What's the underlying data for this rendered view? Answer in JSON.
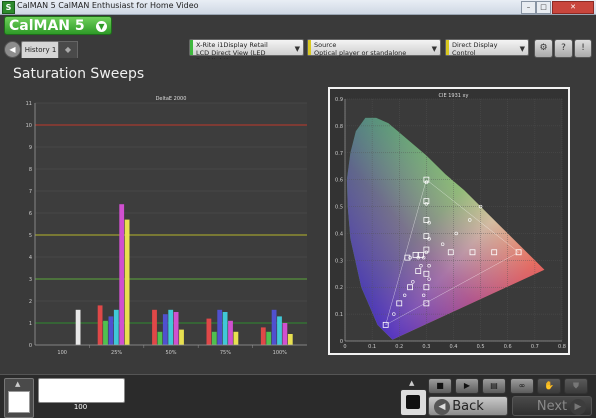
{
  "window": {
    "app_icon": "S",
    "title": "CalMAN 5 CalMAN Enthusiast for Home Video"
  },
  "header": {
    "logo": "CalMAN 5",
    "tab_active": "History 1",
    "meter_label": "X-Rite i1Display Retail",
    "meter_value": "LCD Direct View (LED Backlight)",
    "source_label": "Source",
    "source_value": "Optical player or standalone generator",
    "display_label": "Direct Display Control",
    "display_value": "",
    "colors": {
      "meter": "#3fb83f",
      "source": "#d8c81f",
      "display": "#d8c81f"
    }
  },
  "page": {
    "title": "Saturation Sweeps"
  },
  "chart_data": [
    {
      "type": "bar",
      "title": "DeltaE 2000",
      "categories": [
        "100",
        "25%",
        "50%",
        "75%",
        "100%"
      ],
      "ylim": [
        0,
        11
      ],
      "yticks": [
        0,
        1,
        2,
        3,
        4,
        5,
        6,
        7,
        8,
        9,
        10,
        11
      ],
      "threshold_lines": [
        {
          "y": 10,
          "color": "#c0392b"
        },
        {
          "y": 5,
          "color": "#b5b52a"
        },
        {
          "y": 3,
          "color": "#5aa63a"
        },
        {
          "y": 1,
          "color": "#2e8b2e"
        }
      ],
      "series": [
        {
          "color": "#e04848",
          "values": [
            0,
            1.8,
            1.6,
            1.2,
            0.8
          ]
        },
        {
          "color": "#50c050",
          "values": [
            0,
            1.1,
            0.6,
            0.6,
            0.6
          ]
        },
        {
          "color": "#5050d0",
          "values": [
            0,
            1.3,
            1.4,
            1.6,
            1.6
          ]
        },
        {
          "color": "#40c8d8",
          "values": [
            0,
            1.6,
            1.6,
            1.5,
            1.3
          ]
        },
        {
          "color": "#d050d0",
          "values": [
            0,
            6.4,
            1.5,
            1.1,
            1.0
          ]
        },
        {
          "color": "#e8e050",
          "values": [
            0,
            5.7,
            0.7,
            0.6,
            0.5
          ]
        },
        {
          "color": "#e8e8e8",
          "values": [
            1.6,
            0,
            0,
            0,
            0
          ]
        }
      ],
      "grid": true
    },
    {
      "type": "scatter",
      "title": "CIE 1931 xy",
      "xlim": [
        0,
        0.8
      ],
      "ylim": [
        0,
        0.9
      ],
      "xticks": [
        0,
        0.1,
        0.2,
        0.3,
        0.4,
        0.5,
        0.6,
        0.7,
        0.8
      ],
      "yticks": [
        0,
        0.1,
        0.2,
        0.3,
        0.4,
        0.5,
        0.6,
        0.7,
        0.8,
        0.9
      ],
      "target_points": [
        [
          0.3,
          0.6
        ],
        [
          0.3,
          0.52
        ],
        [
          0.3,
          0.45
        ],
        [
          0.3,
          0.39
        ],
        [
          0.3,
          0.34
        ],
        [
          0.64,
          0.33
        ],
        [
          0.55,
          0.33
        ],
        [
          0.47,
          0.33
        ],
        [
          0.39,
          0.33
        ],
        [
          0.15,
          0.06
        ],
        [
          0.2,
          0.14
        ],
        [
          0.24,
          0.2
        ],
        [
          0.27,
          0.26
        ],
        [
          0.3,
          0.14
        ],
        [
          0.3,
          0.2
        ],
        [
          0.3,
          0.25
        ],
        [
          0.23,
          0.31
        ],
        [
          0.26,
          0.32
        ],
        [
          0.28,
          0.32
        ]
      ],
      "measured_points": [
        [
          0.3,
          0.59
        ],
        [
          0.3,
          0.51
        ],
        [
          0.31,
          0.44
        ],
        [
          0.31,
          0.38
        ],
        [
          0.3,
          0.33
        ],
        [
          0.5,
          0.5
        ],
        [
          0.46,
          0.45
        ],
        [
          0.41,
          0.4
        ],
        [
          0.36,
          0.36
        ],
        [
          0.18,
          0.1
        ],
        [
          0.22,
          0.17
        ],
        [
          0.25,
          0.22
        ],
        [
          0.28,
          0.28
        ],
        [
          0.29,
          0.17
        ],
        [
          0.31,
          0.23
        ],
        [
          0.31,
          0.28
        ],
        [
          0.24,
          0.31
        ],
        [
          0.27,
          0.31
        ],
        [
          0.29,
          0.31
        ]
      ],
      "gamut": [
        [
          0.64,
          0.33
        ],
        [
          0.3,
          0.6
        ],
        [
          0.15,
          0.06
        ]
      ]
    }
  ],
  "bottom": {
    "patch_label": "100",
    "back_label": "Back",
    "next_label": "Next"
  }
}
